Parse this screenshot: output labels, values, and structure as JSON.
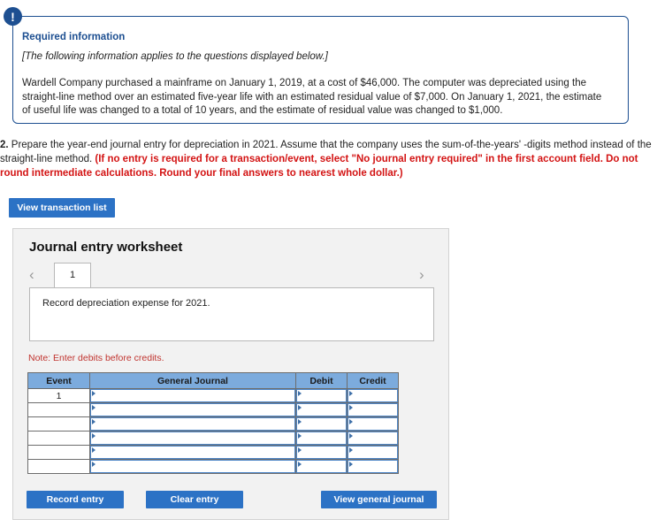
{
  "required_info": {
    "icon": "exclamation-icon",
    "title": "Required information",
    "subtitle": "[The following information applies to the questions displayed below.]",
    "body": "Wardell Company purchased a mainframe on January 1, 2019, at a cost of $46,000. The computer was depreciated using the straight-line method over an estimated five-year life with an estimated residual value of $7,000. On January 1, 2021, the estimate of useful life was changed to a total of 10 years, and the estimate of residual value was changed to $1,000.",
    "border_color": "#1d4f91",
    "title_color": "#1d4f91",
    "icon_glyph": "!"
  },
  "question": {
    "number": "2.",
    "text_part1": " Prepare the year-end journal entry for depreciation in 2021. Assume that the company uses the sum-of-the-years' -digits method instead of the straight-line method. ",
    "text_emphasis": "(If no entry is required for a transaction/event, select \"No journal entry required\" in the first account field. Do not round intermediate calculations. Round your final answers to nearest whole dollar.)",
    "emphasis_color": "#d31313"
  },
  "toolbar": {
    "view_transaction_list_label": "View transaction list"
  },
  "worksheet": {
    "title": "Journal entry worksheet",
    "prev_arrow_icon": "chevron-left-icon",
    "next_arrow_icon": "chevron-right-icon",
    "prev_arrow_glyph": "‹",
    "next_arrow_glyph": "›",
    "tabs": [
      {
        "label": "1",
        "active": true
      }
    ],
    "description": "Record depreciation expense for 2021.",
    "note": "Note: Enter debits before credits.",
    "note_color": "#c0332e",
    "table": {
      "header_bg": "#7cabdd",
      "columns": [
        "Event",
        "General Journal",
        "Debit",
        "Credit"
      ],
      "rows": [
        {
          "event": "1",
          "general_journal": "",
          "debit": "",
          "credit": ""
        },
        {
          "event": "",
          "general_journal": "",
          "debit": "",
          "credit": ""
        },
        {
          "event": "",
          "general_journal": "",
          "debit": "",
          "credit": ""
        },
        {
          "event": "",
          "general_journal": "",
          "debit": "",
          "credit": ""
        },
        {
          "event": "",
          "general_journal": "",
          "debit": "",
          "credit": ""
        },
        {
          "event": "",
          "general_journal": "",
          "debit": "",
          "credit": ""
        }
      ]
    },
    "buttons": {
      "record_entry": "Record entry",
      "clear_entry": "Clear entry",
      "view_general_journal": "View general journal",
      "color": "#2c72c5"
    }
  }
}
